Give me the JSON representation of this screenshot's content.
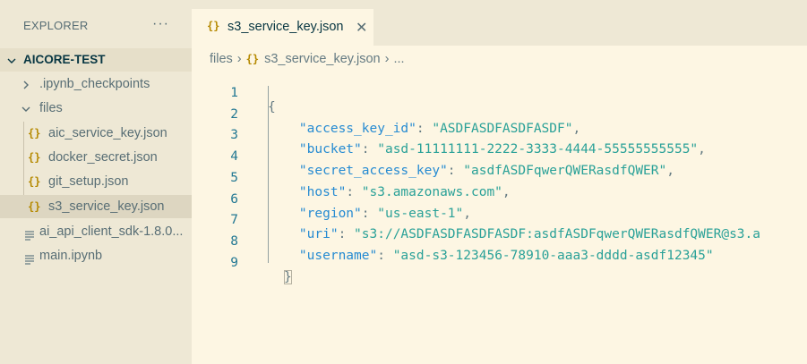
{
  "sidebar": {
    "header": "EXPLORER",
    "more": "···",
    "items": [
      {
        "label": "AICORE-TEST",
        "type": "root"
      },
      {
        "label": ".ipynb_checkpoints",
        "type": "folder"
      },
      {
        "label": "files",
        "type": "folder"
      },
      {
        "label": "aic_service_key.json",
        "type": "json"
      },
      {
        "label": "docker_secret.json",
        "type": "json"
      },
      {
        "label": "git_setup.json",
        "type": "json"
      },
      {
        "label": "s3_service_key.json",
        "type": "json"
      },
      {
        "label": "ai_api_client_sdk-1.8.0...",
        "type": "file"
      },
      {
        "label": "main.ipynb",
        "type": "file"
      }
    ]
  },
  "json_icon": "{}",
  "tab": {
    "label": "s3_service_key.json",
    "close": "✕"
  },
  "breadcrumb": {
    "folder": "files",
    "file": "s3_service_key.json",
    "more": "..."
  },
  "editor": {
    "lines": [
      {
        "n": "1",
        "open": "{"
      },
      {
        "n": "2",
        "key": "\"access_key_id\"",
        "value": "\"ASDFASDFASDFASDF\"",
        "comma": ","
      },
      {
        "n": "3",
        "key": "\"bucket\"",
        "value": "\"asd-11111111-2222-3333-4444-55555555555\"",
        "comma": ","
      },
      {
        "n": "4",
        "key": "\"secret_access_key\"",
        "value": "\"asdfASDFqwerQWERasdfQWER\"",
        "comma": ","
      },
      {
        "n": "5",
        "key": "\"host\"",
        "value": "\"s3.amazonaws.com\"",
        "comma": ","
      },
      {
        "n": "6",
        "key": "\"region\"",
        "value": "\"us-east-1\"",
        "comma": ","
      },
      {
        "n": "7",
        "key": "\"uri\"",
        "value": "\"s3://ASDFASDFASDFASDF:asdfASDFqwerQWERasdfQWER@s3.a",
        "comma": ""
      },
      {
        "n": "8",
        "key": "\"username\"",
        "value": "\"asd-s3-123456-78910-aaa3-dddd-asdf12345\"",
        "comma": ""
      },
      {
        "n": "9",
        "close": "}"
      }
    ]
  }
}
